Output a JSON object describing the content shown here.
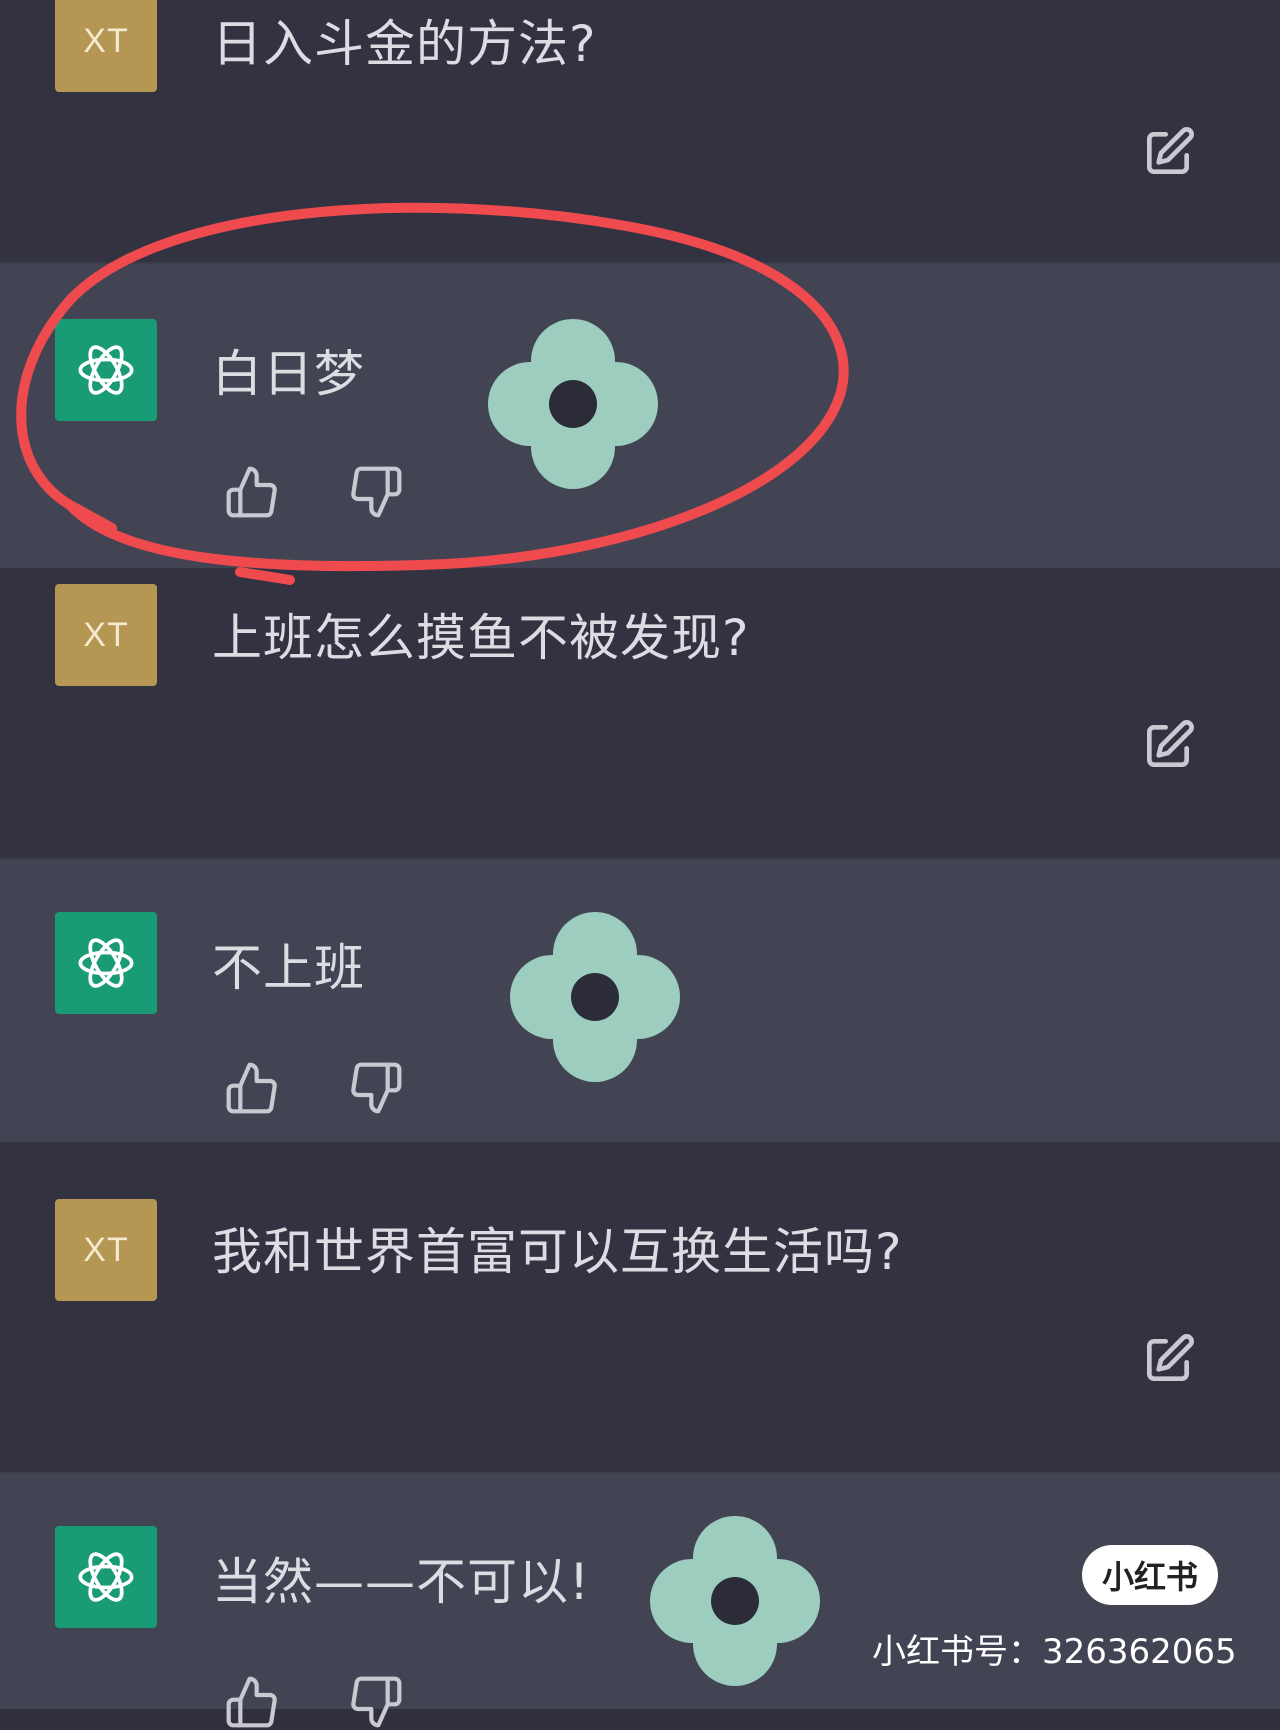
{
  "messages": [
    {
      "role": "user",
      "avatar": "XT",
      "text": "日入斗金的方法?"
    },
    {
      "role": "assistant",
      "text": "白日梦"
    },
    {
      "role": "user",
      "avatar": "XT",
      "text": "上班怎么摸鱼不被发现?"
    },
    {
      "role": "assistant",
      "text": "不上班"
    },
    {
      "role": "user",
      "avatar": "XT",
      "text": "我和世界首富可以互换生活吗?"
    },
    {
      "role": "assistant",
      "text": "当然——不可以!"
    }
  ],
  "icons": {
    "edit": "edit-icon",
    "thumbs_up": "thumbs-up-icon",
    "thumbs_down": "thumbs-down-icon",
    "assistant_logo": "chatgpt-logo-icon",
    "sticker": "flower-sticker-icon"
  },
  "colors": {
    "user_bg": "#323241",
    "assistant_bg": "#434453",
    "user_avatar": "#b59652",
    "assistant_avatar": "#199c76",
    "annotation_circle": "#ef4b4e",
    "flower": "#9ccdbf"
  },
  "watermark": {
    "badge": "小红书",
    "id_text": "小红书号：326362065"
  }
}
